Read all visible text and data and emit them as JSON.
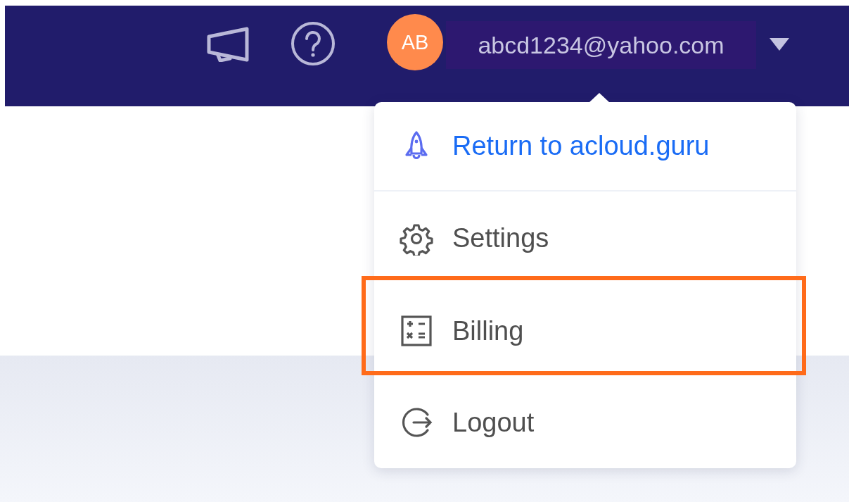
{
  "header": {
    "avatar_initials": "AB",
    "email": "abcd1234@yahoo.com"
  },
  "menu": {
    "items": [
      {
        "label": "Return to acloud.guru",
        "kind": "link",
        "highlighted": false
      },
      {
        "label": "Settings",
        "kind": "plain",
        "highlighted": false
      },
      {
        "label": "Billing",
        "kind": "plain",
        "highlighted": true
      },
      {
        "label": "Logout",
        "kind": "plain",
        "highlighted": false
      }
    ]
  }
}
